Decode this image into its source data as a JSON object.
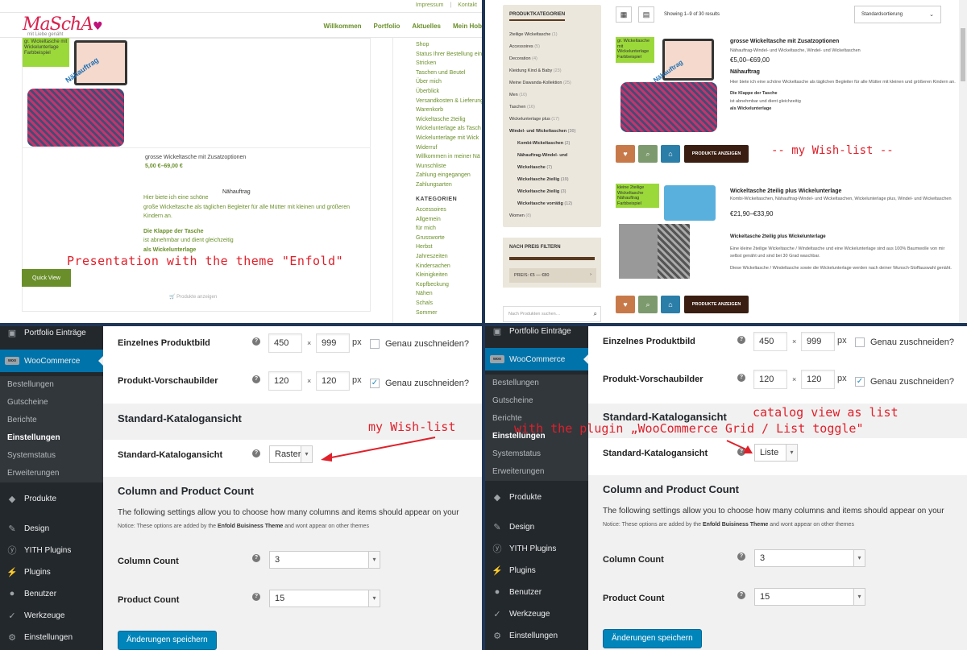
{
  "enfold": {
    "top_links": [
      "Impressum",
      "Kontakt"
    ],
    "logo": "MaSchA",
    "logo_sub": "mit Liebe genäht",
    "nav": [
      "Willkommen",
      "Portfolio",
      "Aktuelles",
      "Mein Hob"
    ],
    "badge": "gr. Wickeltasche mit Wickelunterlage Farbbeispiel",
    "stamp": "Nähauftrag",
    "product_title": "grosse Wickeltasche mit Zusatzoptionen",
    "product_price": "5,00 €–69,00 €",
    "naehauftrag": "Nähauftrag",
    "desc_line1": "Hier biete ich eine schöne",
    "desc_line2": "große Wickeltasche als täglichen Begleiter für alle Mütter mit kleinen und größeren Kindern an.",
    "desc_bold": "Die Klappe der Tasche",
    "desc_line3": "ist abnehmbar und dient gleichzeitig",
    "desc_bold2": "als Wickelunterlage",
    "quick_view": "Quick View",
    "show_products": "Produkte anzeigen",
    "annotation": "Presentation with the theme \"Enfold\"",
    "sidebar_links": [
      "Shop",
      "Status Ihrer Bestellung ein",
      "Stricken",
      "Taschen und Beutel",
      "Über mich",
      "Überblick",
      "Versandkosten & Lieferung",
      "Warenkorb",
      "Wickeltasche 2teilig",
      "Wickelunterlage als Tasch",
      "Wickelunterlage mit Wick",
      "Widerruf",
      "Willkommen in meiner Nä",
      "Wunschliste",
      "Zahlung eingegangen",
      "Zahlungsarten"
    ],
    "kategorien_title": "KATEGORIEN",
    "kategorien": [
      "Accessoires",
      "Allgemein",
      "für mich",
      "Grussworte",
      "Herbst",
      "Jahreszeiten",
      "Kindersachen",
      "Kleinigkeiten",
      "Kopfbeckung",
      "Nähen",
      "Schals",
      "Sommer"
    ]
  },
  "wishlist": {
    "sidebar_title": "PRODUKTKATEGORIEN",
    "categories": [
      {
        "name": "2teilige Wickeltasche",
        "count": "(1)",
        "sub": false
      },
      {
        "name": "Accessoires",
        "count": "(5)",
        "sub": false
      },
      {
        "name": "Decoration",
        "count": "(4)",
        "sub": false
      },
      {
        "name": "Kleidung Kind & Baby",
        "count": "(23)",
        "sub": false
      },
      {
        "name": "Meine Dawanda-Kollektion",
        "count": "(25)",
        "sub": false
      },
      {
        "name": "Men",
        "count": "(10)",
        "sub": false
      },
      {
        "name": "Taschen",
        "count": "(16)",
        "sub": false
      },
      {
        "name": "Wickelunterlage plus",
        "count": "(17)",
        "sub": false
      },
      {
        "name": "Windel- und Wickeltaschen",
        "count": "(30)",
        "sub": false
      },
      {
        "name": "Kombi-Wickeltaschen",
        "count": "(2)",
        "sub": true
      },
      {
        "name": "Nähauftrag-Windel- und",
        "count": "",
        "sub": true
      },
      {
        "name": "Wickeltasche",
        "count": "(7)",
        "sub": true
      },
      {
        "name": "Wickeltasche 2teilig",
        "count": "(19)",
        "sub": true
      },
      {
        "name": "Wickeltasche 2teilig",
        "count": "(3)",
        "sub": true
      },
      {
        "name": "Wickeltasche vorrätig",
        "count": "(12)",
        "sub": true
      },
      {
        "name": "Women",
        "count": "(8)",
        "sub": false
      }
    ],
    "price_filter_title": "NACH PREIS FILTERN",
    "price_range": "PREIS: €5 — €80",
    "search_placeholder": "Nach Produkten suchen…",
    "showing": "Showing 1–9 of 30 results",
    "sort": "Standardsortierung",
    "show_btn": "PRODUKTE ANZEIGEN",
    "annotation": "-- my Wish-list --",
    "products": [
      {
        "title": "grosse Wickeltasche mit Zusatzoptionen",
        "cats": "Nähauftrag-Windel- und Wickeltasche, Windel- und Wickeltaschen",
        "price": "€5,00–€69,00",
        "tag": "Nähauftrag",
        "text1": "Hier biete ich eine schöne Wickeltasche als täglichen Begleiter für alle Mütter mit kleinen und größeren Kindern an.",
        "bold": "Die Klappe der Tasche",
        "text2": "ist abnehmbar und dient gleichzeitig",
        "bold2": "als Wickelunterlage",
        "badge": "gr. Wickeltasche mit Wickelunterlage Farbbeispiel"
      },
      {
        "title": "Wickeltasche 2teilig plus Wickelunterlage",
        "cats": "Kombi-Wickeltaschen, Nähauftrag-Windel- und Wickeltaschen, Wickelunterlage plus, Windel- und Wickeltaschen",
        "price": "€21,90–€33,90",
        "tag": "Wickeltasche 2teilig plus Wickelunterlage",
        "text1": "Eine kleine 2teilige Wickeltasche / Windeltasche und eine Wickelunterlage sind aus 100% Baumwolle von mir selbst genäht und sind bei 30 Grad waschbar.",
        "text2": "Diese Wickeltasche / Windeltasche sowie die Wickelunterlage werden nach deiner Wunsch-Stoffauswahl genäht.",
        "badge": "kleine 2teilige Wickeltasche Nähauftrag Farbbeispiel"
      }
    ]
  },
  "admin_left": {
    "menu_top": "Portfolio Einträge",
    "woocommerce": "WooCommerce",
    "woo_icon": "woo",
    "submenu": [
      "Bestellungen",
      "Gutscheine",
      "Berichte",
      "Einstellungen",
      "Systemstatus",
      "Erweiterungen"
    ],
    "menu_bottom": [
      "Produkte",
      "Design",
      "YITH Plugins",
      "Plugins",
      "Benutzer",
      "Werkzeuge",
      "Einstellungen"
    ],
    "single_image_label": "Einzelnes Produktbild",
    "single_w": "450",
    "single_h": "999",
    "thumb_label": "Produkt-Vorschaubilder",
    "thumb_w": "120",
    "thumb_h": "120",
    "crop_label": "Genau zuschneiden?",
    "px": "px",
    "times": "×",
    "catalog_heading": "Standard-Katalogansicht",
    "catalog_label": "Standard-Katalogansicht",
    "catalog_value": "Raster",
    "column_heading": "Column and Product Count",
    "column_desc": "The following settings allow you to choose how many columns and items should appear on your",
    "notice_pre": "Notice: These options are added by the",
    "notice_bold": "Enfold Buisiness Theme",
    "notice_post": "and wont appear on other themes",
    "column_label": "Column Count",
    "column_value": "3",
    "product_label": "Product Count",
    "product_value": "15",
    "save": "Änderungen speichern",
    "annotation": "my Wish-list"
  },
  "admin_right": {
    "catalog_value": "Liste",
    "annotation1": "catalog view as list",
    "annotation2": "with the plugin „WooCommerce Grid / List toggle\""
  }
}
